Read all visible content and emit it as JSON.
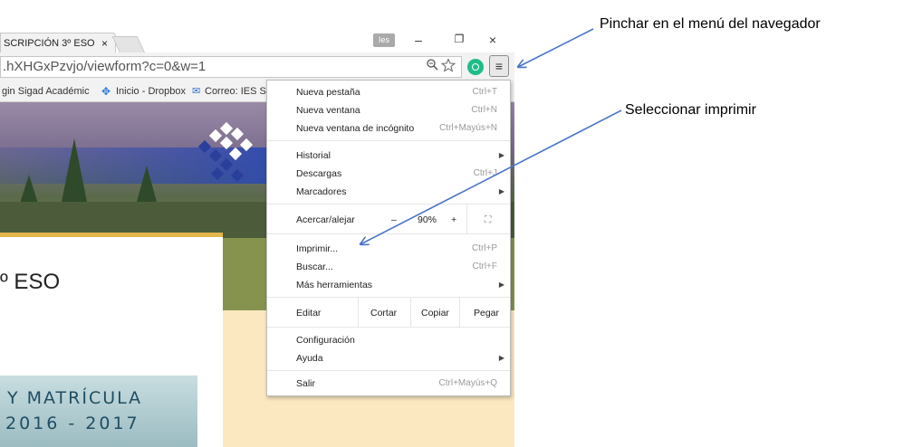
{
  "browser": {
    "tab_title": "SCRIPCIÓN 3º ESO",
    "tab_close": "×",
    "profile_label": "Ies",
    "minimize": "–",
    "restore": "❐",
    "close": "×",
    "url": ".hXHGxPzvjo/viewform?c=0&w=1",
    "zoom_icon": "zoom-icon",
    "star_icon": "star-icon",
    "menu_icon": "≡"
  },
  "bookmarks": [
    {
      "label": "gin Sigad Académic"
    },
    {
      "label": "Inicio - Dropbox"
    },
    {
      "label": "Correo: IES S"
    }
  ],
  "page": {
    "card_title": "º ESO",
    "image_line1": "Y MATRÍCULA",
    "image_line2": "2016 - 2017"
  },
  "menu": {
    "new_tab": "Nueva pestaña",
    "new_tab_sc": "Ctrl+T",
    "new_window": "Nueva ventana",
    "new_window_sc": "Ctrl+N",
    "incognito": "Nueva ventana de incógnito",
    "incognito_sc": "Ctrl+Mayús+N",
    "history": "Historial",
    "downloads": "Descargas",
    "downloads_sc": "Ctrl+J",
    "bookmarks": "Marcadores",
    "zoom_label": "Acercar/alejar",
    "zoom_minus": "–",
    "zoom_value": "90%",
    "zoom_plus": "+",
    "fullscreen": "⛶",
    "print": "Imprimir...",
    "print_sc": "Ctrl+P",
    "find": "Buscar...",
    "find_sc": "Ctrl+F",
    "more_tools": "Más herramientas",
    "edit": "Editar",
    "cut": "Cortar",
    "copy": "Copiar",
    "paste": "Pegar",
    "settings": "Configuración",
    "help": "Ayuda",
    "exit": "Salir",
    "exit_sc": "Ctrl+Mayús+Q"
  },
  "annotations": {
    "menu_hint": "Pinchar en  el menú del navegador",
    "print_hint": "Seleccionar imprimir"
  },
  "colors": {
    "arrow": "#4a76c9",
    "card_border": "#e3b64a",
    "page_bg": "#fbe8c0"
  }
}
